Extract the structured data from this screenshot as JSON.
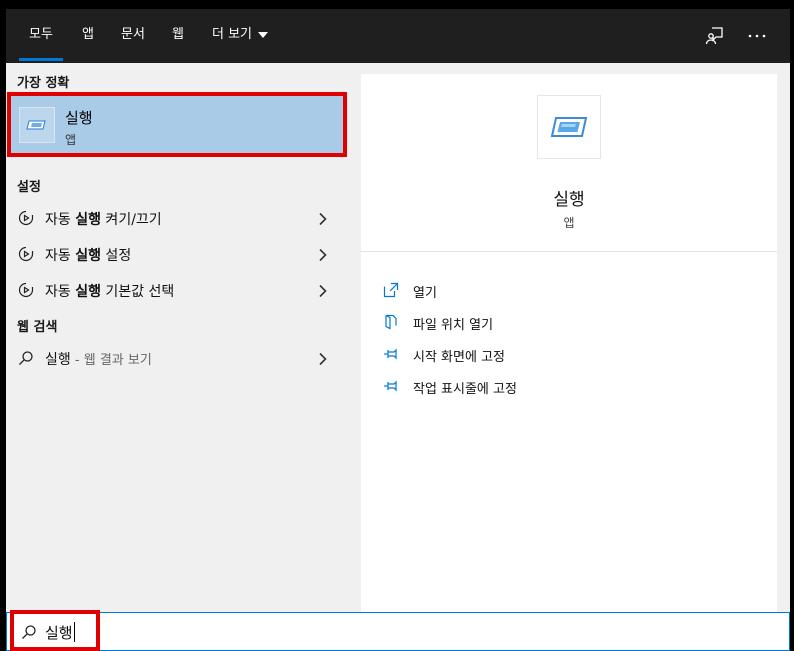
{
  "tabs": [
    {
      "label": "모두",
      "active": true
    },
    {
      "label": "앱"
    },
    {
      "label": "문서"
    },
    {
      "label": "웹"
    },
    {
      "label": "더 보기"
    }
  ],
  "top_icons": [
    "feedback-icon",
    "more-options-icon"
  ],
  "best_match": {
    "heading": "가장 정확",
    "title": "실행",
    "subtitle": "앱",
    "icon": "run-app-icon"
  },
  "settings": {
    "heading": "설정",
    "items": [
      {
        "prefix": "자동 ",
        "bold": "실행",
        "suffix": " 켜기/끄기",
        "icon": "autoplay-icon"
      },
      {
        "prefix": "자동 ",
        "bold": "실행",
        "suffix": " 설정",
        "icon": "autoplay-icon"
      },
      {
        "prefix": "자동 ",
        "bold": "실행",
        "suffix": " 기본값 선택",
        "icon": "autoplay-icon"
      }
    ]
  },
  "web_search": {
    "heading": "웹 검색",
    "query": "실행",
    "suffix": " - 웹 결과 보기",
    "icon": "search-icon"
  },
  "preview": {
    "title": "실행",
    "subtitle": "앱",
    "actions": [
      {
        "label": "열기",
        "icon": "open-icon"
      },
      {
        "label": "파일 위치 열기",
        "icon": "file-location-icon"
      },
      {
        "label": "시작 화면에 고정",
        "icon": "pin-icon"
      },
      {
        "label": "작업 표시줄에 고정",
        "icon": "pin-icon"
      }
    ]
  },
  "search": {
    "value": "실행",
    "icon": "search-icon"
  },
  "colors": {
    "accent": "#0078d7",
    "highlight": "#aacbe8",
    "annotation": "#e00000",
    "topbar": "#1f1f1f"
  }
}
